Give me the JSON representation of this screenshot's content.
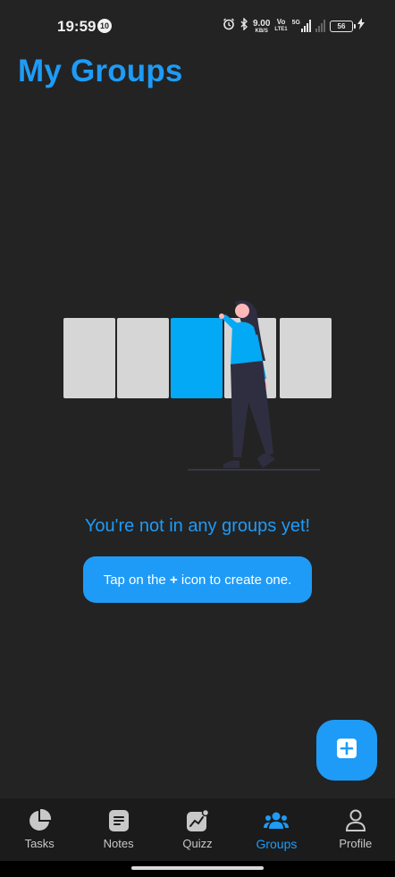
{
  "status_bar": {
    "time": "19:59",
    "notification_count": "10",
    "net_speed_value": "9.00",
    "net_speed_unit": "KB/S",
    "volte_top": "Vo",
    "volte_bottom": "LTE1",
    "network_type": "5G",
    "battery_level": "56"
  },
  "header": {
    "title": "My Groups"
  },
  "empty_state": {
    "message": "You're not in any groups yet!",
    "hint_prefix": "Tap on the ",
    "hint_plus": "+",
    "hint_suffix": " icon to create one."
  },
  "fab": {
    "icon": "add-box-icon"
  },
  "bottom_nav": {
    "items": [
      {
        "label": "Tasks",
        "icon": "pie-chart-icon"
      },
      {
        "label": "Notes",
        "icon": "note-icon"
      },
      {
        "label": "Quizz",
        "icon": "quiz-chart-icon"
      },
      {
        "label": "Groups",
        "icon": "groups-icon",
        "active": true
      },
      {
        "label": "Profile",
        "icon": "person-icon"
      }
    ]
  },
  "colors": {
    "background": "#232323",
    "accent": "#1e9bf7",
    "nav_background": "#1b1b1b",
    "inactive": "#c8c8c8"
  }
}
